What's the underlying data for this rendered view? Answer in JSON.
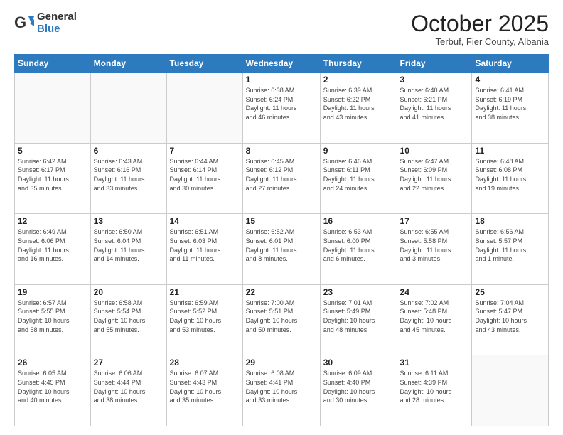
{
  "logo": {
    "general": "General",
    "blue": "Blue"
  },
  "header": {
    "month": "October 2025",
    "location": "Terbuf, Fier County, Albania"
  },
  "weekdays": [
    "Sunday",
    "Monday",
    "Tuesday",
    "Wednesday",
    "Thursday",
    "Friday",
    "Saturday"
  ],
  "weeks": [
    [
      {
        "day": "",
        "info": ""
      },
      {
        "day": "",
        "info": ""
      },
      {
        "day": "",
        "info": ""
      },
      {
        "day": "1",
        "info": "Sunrise: 6:38 AM\nSunset: 6:24 PM\nDaylight: 11 hours\nand 46 minutes."
      },
      {
        "day": "2",
        "info": "Sunrise: 6:39 AM\nSunset: 6:22 PM\nDaylight: 11 hours\nand 43 minutes."
      },
      {
        "day": "3",
        "info": "Sunrise: 6:40 AM\nSunset: 6:21 PM\nDaylight: 11 hours\nand 41 minutes."
      },
      {
        "day": "4",
        "info": "Sunrise: 6:41 AM\nSunset: 6:19 PM\nDaylight: 11 hours\nand 38 minutes."
      }
    ],
    [
      {
        "day": "5",
        "info": "Sunrise: 6:42 AM\nSunset: 6:17 PM\nDaylight: 11 hours\nand 35 minutes."
      },
      {
        "day": "6",
        "info": "Sunrise: 6:43 AM\nSunset: 6:16 PM\nDaylight: 11 hours\nand 33 minutes."
      },
      {
        "day": "7",
        "info": "Sunrise: 6:44 AM\nSunset: 6:14 PM\nDaylight: 11 hours\nand 30 minutes."
      },
      {
        "day": "8",
        "info": "Sunrise: 6:45 AM\nSunset: 6:12 PM\nDaylight: 11 hours\nand 27 minutes."
      },
      {
        "day": "9",
        "info": "Sunrise: 6:46 AM\nSunset: 6:11 PM\nDaylight: 11 hours\nand 24 minutes."
      },
      {
        "day": "10",
        "info": "Sunrise: 6:47 AM\nSunset: 6:09 PM\nDaylight: 11 hours\nand 22 minutes."
      },
      {
        "day": "11",
        "info": "Sunrise: 6:48 AM\nSunset: 6:08 PM\nDaylight: 11 hours\nand 19 minutes."
      }
    ],
    [
      {
        "day": "12",
        "info": "Sunrise: 6:49 AM\nSunset: 6:06 PM\nDaylight: 11 hours\nand 16 minutes."
      },
      {
        "day": "13",
        "info": "Sunrise: 6:50 AM\nSunset: 6:04 PM\nDaylight: 11 hours\nand 14 minutes."
      },
      {
        "day": "14",
        "info": "Sunrise: 6:51 AM\nSunset: 6:03 PM\nDaylight: 11 hours\nand 11 minutes."
      },
      {
        "day": "15",
        "info": "Sunrise: 6:52 AM\nSunset: 6:01 PM\nDaylight: 11 hours\nand 8 minutes."
      },
      {
        "day": "16",
        "info": "Sunrise: 6:53 AM\nSunset: 6:00 PM\nDaylight: 11 hours\nand 6 minutes."
      },
      {
        "day": "17",
        "info": "Sunrise: 6:55 AM\nSunset: 5:58 PM\nDaylight: 11 hours\nand 3 minutes."
      },
      {
        "day": "18",
        "info": "Sunrise: 6:56 AM\nSunset: 5:57 PM\nDaylight: 11 hours\nand 1 minute."
      }
    ],
    [
      {
        "day": "19",
        "info": "Sunrise: 6:57 AM\nSunset: 5:55 PM\nDaylight: 10 hours\nand 58 minutes."
      },
      {
        "day": "20",
        "info": "Sunrise: 6:58 AM\nSunset: 5:54 PM\nDaylight: 10 hours\nand 55 minutes."
      },
      {
        "day": "21",
        "info": "Sunrise: 6:59 AM\nSunset: 5:52 PM\nDaylight: 10 hours\nand 53 minutes."
      },
      {
        "day": "22",
        "info": "Sunrise: 7:00 AM\nSunset: 5:51 PM\nDaylight: 10 hours\nand 50 minutes."
      },
      {
        "day": "23",
        "info": "Sunrise: 7:01 AM\nSunset: 5:49 PM\nDaylight: 10 hours\nand 48 minutes."
      },
      {
        "day": "24",
        "info": "Sunrise: 7:02 AM\nSunset: 5:48 PM\nDaylight: 10 hours\nand 45 minutes."
      },
      {
        "day": "25",
        "info": "Sunrise: 7:04 AM\nSunset: 5:47 PM\nDaylight: 10 hours\nand 43 minutes."
      }
    ],
    [
      {
        "day": "26",
        "info": "Sunrise: 6:05 AM\nSunset: 4:45 PM\nDaylight: 10 hours\nand 40 minutes."
      },
      {
        "day": "27",
        "info": "Sunrise: 6:06 AM\nSunset: 4:44 PM\nDaylight: 10 hours\nand 38 minutes."
      },
      {
        "day": "28",
        "info": "Sunrise: 6:07 AM\nSunset: 4:43 PM\nDaylight: 10 hours\nand 35 minutes."
      },
      {
        "day": "29",
        "info": "Sunrise: 6:08 AM\nSunset: 4:41 PM\nDaylight: 10 hours\nand 33 minutes."
      },
      {
        "day": "30",
        "info": "Sunrise: 6:09 AM\nSunset: 4:40 PM\nDaylight: 10 hours\nand 30 minutes."
      },
      {
        "day": "31",
        "info": "Sunrise: 6:11 AM\nSunset: 4:39 PM\nDaylight: 10 hours\nand 28 minutes."
      },
      {
        "day": "",
        "info": ""
      }
    ]
  ]
}
